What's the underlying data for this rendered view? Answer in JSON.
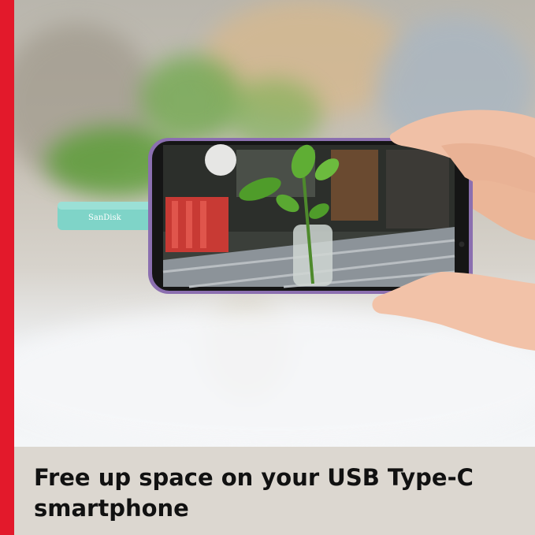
{
  "caption": {
    "headline": "Free up space on your USB Type-C smartphone"
  },
  "product": {
    "brand_on_drive": "SanDisk"
  },
  "colors": {
    "brand_red": "#e3192b",
    "caption_background": "#dcd7d0",
    "drive_teal": "#7fd4c8",
    "phone_purple": "#8b6fb0"
  }
}
